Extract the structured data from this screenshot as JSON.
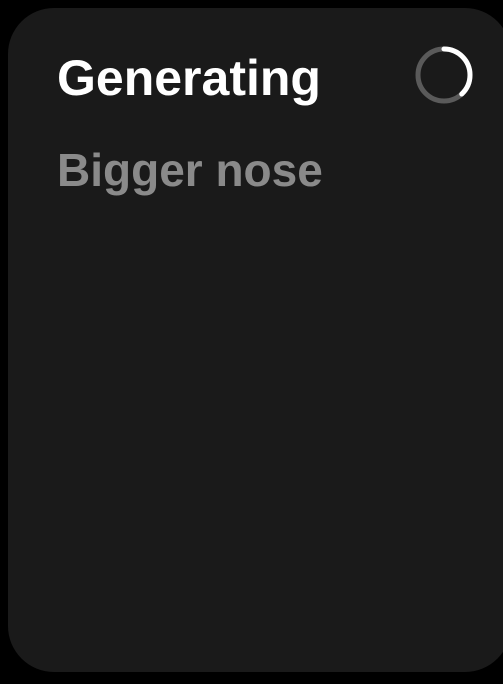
{
  "status": {
    "title": "Generating",
    "prompt": "Bigger nose",
    "progress_fraction": 0.38
  },
  "icons": {
    "spinner": "loading-spinner-icon"
  },
  "colors": {
    "background": "#000000",
    "card": "#1a1a1a",
    "title": "#ffffff",
    "subtitle": "#8a8a8a",
    "spinner_track": "#5a5a5a",
    "spinner_arc": "#ffffff"
  }
}
